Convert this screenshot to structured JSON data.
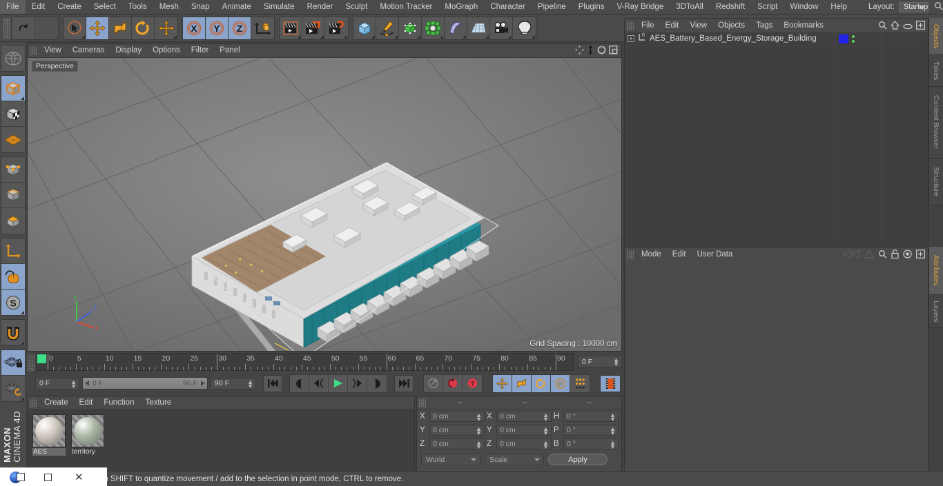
{
  "app": {
    "title": "CINEMA 4D",
    "brand_top": "MAXON",
    "brand_bottom": "CINEMA 4D"
  },
  "menubar": {
    "items": [
      "File",
      "Edit",
      "Create",
      "Select",
      "Tools",
      "Mesh",
      "Snap",
      "Animate",
      "Simulate",
      "Render",
      "Sculpt",
      "Motion Tracker",
      "MoGraph",
      "Character",
      "Pipeline",
      "Plugins",
      "V-Ray Bridge",
      "3DToAll",
      "Redshift",
      "Script",
      "Window",
      "Help"
    ],
    "layout_label": "Layout:",
    "layout_value": "Startup",
    "search_icon": "search-icon"
  },
  "toolbar": {
    "groups": [
      {
        "name": "undo-redo",
        "buttons": [
          {
            "name": "undo-button",
            "icon": "undo-arrow-icon",
            "selected": false,
            "dim": false
          },
          {
            "name": "redo-button",
            "icon": "redo-arrow-icon",
            "selected": false,
            "dim": true
          }
        ]
      },
      {
        "name": "transform-tools",
        "buttons": [
          {
            "name": "live-selection-tool",
            "icon": "cursor-circle-icon",
            "selected": false,
            "dim": false
          },
          {
            "name": "move-tool",
            "icon": "move-arrows-icon",
            "selected": true,
            "dim": false
          },
          {
            "name": "scale-tool",
            "icon": "scale-box-icon",
            "selected": false,
            "dim": false
          },
          {
            "name": "rotate-tool",
            "icon": "rotate-arc-icon",
            "selected": false,
            "dim": false
          },
          {
            "name": "dynamic-place-tool",
            "icon": "move-arrows-icon",
            "selected": false,
            "dim": false
          }
        ]
      },
      {
        "name": "axis-locks",
        "buttons": [
          {
            "name": "lock-x-axis-button",
            "icon": "x-axis-icon",
            "selected": true,
            "dim": false
          },
          {
            "name": "lock-y-axis-button",
            "icon": "y-axis-icon",
            "selected": true,
            "dim": false
          },
          {
            "name": "lock-z-axis-button",
            "icon": "z-axis-icon",
            "selected": true,
            "dim": false
          },
          {
            "name": "world-object-axis-button",
            "icon": "world-axis-cube-icon",
            "selected": false,
            "dim": false
          }
        ]
      },
      {
        "name": "render-tools",
        "buttons": [
          {
            "name": "render-view-button",
            "icon": "clapper-view-icon",
            "selected": false,
            "dim": false
          },
          {
            "name": "render-to-picture-viewer-button",
            "icon": "clapper-picture-icon",
            "selected": false,
            "dim": false
          },
          {
            "name": "render-settings-button",
            "icon": "clapper-gear-icon",
            "selected": false,
            "dim": false
          }
        ]
      },
      {
        "name": "object-creation",
        "buttons": [
          {
            "name": "add-cube-button",
            "icon": "cube-blue-icon",
            "selected": false,
            "dim": false
          },
          {
            "name": "add-spline-button",
            "icon": "pen-spline-icon",
            "selected": false,
            "dim": false
          },
          {
            "name": "nurbs-button",
            "icon": "green-cube-points-icon",
            "selected": false,
            "dim": false
          },
          {
            "name": "array-button",
            "icon": "green-cluster-icon",
            "selected": false,
            "dim": false
          },
          {
            "name": "deformer-button",
            "icon": "bend-deformer-icon",
            "selected": false,
            "dim": false
          },
          {
            "name": "scene-object-button",
            "icon": "floor-grid-icon",
            "selected": false,
            "dim": false
          },
          {
            "name": "camera-button",
            "icon": "camera-icon",
            "selected": false,
            "dim": false
          },
          {
            "name": "light-button",
            "icon": "light-bulb-icon",
            "selected": false,
            "dim": false
          }
        ]
      }
    ]
  },
  "left_toolbar": {
    "groups": [
      {
        "name": "world-axis",
        "buttons": [
          {
            "name": "make-editable-globe-button",
            "icon": "globe-wire-icon",
            "selected": false
          }
        ]
      },
      {
        "name": "mode-selection",
        "buttons": [
          {
            "name": "model-mode-button",
            "icon": "model-cube-icon",
            "selected": true
          },
          {
            "name": "texture-mode-button",
            "icon": "texture-checker-cube-icon",
            "selected": false
          },
          {
            "name": "polygon-grid-button",
            "icon": "orange-grid-icon",
            "selected": false
          }
        ]
      },
      {
        "name": "component-modes",
        "buttons": [
          {
            "name": "point-mode-button",
            "icon": "point-cube-icon",
            "selected": false
          },
          {
            "name": "edge-mode-button",
            "icon": "edge-cube-icon",
            "selected": false
          },
          {
            "name": "polygon-mode-button",
            "icon": "polygon-cube-icon",
            "selected": false
          }
        ]
      },
      {
        "name": "axis-modes",
        "buttons": [
          {
            "name": "enable-axis-button",
            "icon": "axis-arrow-icon",
            "selected": false
          },
          {
            "name": "viewport-solo-button",
            "icon": "mouse-curve-icon",
            "selected": true
          },
          {
            "name": "soft-selection-button",
            "icon": "s-circle-icon",
            "selected": true
          }
        ]
      },
      {
        "name": "snapping",
        "buttons": [
          {
            "name": "snap-magnet-button",
            "icon": "magnet-icon",
            "selected": false
          }
        ]
      },
      {
        "name": "workplane",
        "buttons": [
          {
            "name": "lock-workplane-button",
            "icon": "grid-lock-icon",
            "selected": true
          },
          {
            "name": "planar-workplane-button",
            "icon": "grid-rotate-icon",
            "selected": false
          }
        ]
      }
    ]
  },
  "viewport": {
    "menu": [
      "View",
      "Cameras",
      "Display",
      "Options",
      "Filter",
      "Panel"
    ],
    "corner_icons": [
      "pan-icon",
      "dolly-icon",
      "rotate-icon",
      "maximize-icon"
    ],
    "label": "Perspective",
    "grid_spacing": "Grid Spacing : 10000 cm",
    "axis_gizmo": {
      "x": "X",
      "y": "Y",
      "z": "Z",
      "x_color": "#e04a3c",
      "y_color": "#46c246",
      "z_color": "#4060e0"
    },
    "model_title": "AES Battery Based Energy Storage Building"
  },
  "timeline": {
    "ruler": {
      "labels": [
        "0",
        "5",
        "10",
        "15",
        "20",
        "25",
        "30",
        "35",
        "40",
        "45",
        "50",
        "55",
        "60",
        "65",
        "70",
        "75",
        "80",
        "85",
        "90"
      ],
      "min_frame": 0,
      "max_frame": 90,
      "playhead_frames": [
        0,
        30,
        60,
        90
      ]
    },
    "current_frame_top": "0 F",
    "current_frame": "0 F",
    "range_start": "0 F",
    "range_end": "90 F",
    "end_frame": "90 F",
    "transport": [
      {
        "name": "go-to-start-button",
        "icon": "skip-start-icon"
      },
      {
        "name": "step-back-keyframe-button",
        "icon": "prev-key-icon"
      },
      {
        "name": "step-back-frame-button",
        "icon": "step-back-icon"
      },
      {
        "name": "play-button",
        "icon": "play-icon"
      },
      {
        "name": "step-forward-frame-button",
        "icon": "step-forward-icon"
      },
      {
        "name": "next-keyframe-button",
        "icon": "next-key-icon"
      },
      {
        "name": "go-to-end-button",
        "icon": "skip-end-icon"
      }
    ],
    "record_group": [
      {
        "name": "autokey-button",
        "icon": "key-icon",
        "selected": false
      },
      {
        "name": "record-active-objects-button",
        "icon": "record-circle-icon",
        "selected": false
      },
      {
        "name": "keyframe-selection-button",
        "icon": "question-circle-icon",
        "selected": false
      }
    ],
    "key_toggles": [
      {
        "name": "position-key-button",
        "icon": "move-arrows-icon",
        "selected": true
      },
      {
        "name": "scale-key-button",
        "icon": "scale-box-icon",
        "selected": true
      },
      {
        "name": "rotation-key-button",
        "icon": "rotate-arc-icon",
        "selected": true
      },
      {
        "name": "parameter-key-button",
        "icon": "p-circle-icon",
        "selected": true
      },
      {
        "name": "point-level-animation-button",
        "icon": "dots-grid-icon",
        "selected": false
      }
    ],
    "timeline_button": {
      "name": "open-timeline-button",
      "icon": "film-strip-icon",
      "selected": true
    }
  },
  "materials": {
    "menu": [
      "Create",
      "Edit",
      "Function",
      "Texture"
    ],
    "items": [
      {
        "name": "AES",
        "selected": true,
        "color": "#cfc7bd"
      },
      {
        "name": "territory",
        "selected": false,
        "color": "#a9b7a2"
      }
    ]
  },
  "coordinates": {
    "header_dashes": [
      "--",
      "--",
      "--"
    ],
    "rows": [
      {
        "pos_label": "X",
        "pos_value": "0 cm",
        "size_label": "X",
        "size_value": "0 cm",
        "rot_label": "H",
        "rot_value": "0 °"
      },
      {
        "pos_label": "Y",
        "pos_value": "0 cm",
        "size_label": "Y",
        "size_value": "0 cm",
        "rot_label": "P",
        "rot_value": "0 °"
      },
      {
        "pos_label": "Z",
        "pos_value": "0 cm",
        "size_label": "Z",
        "size_value": "0 cm",
        "rot_label": "B",
        "rot_value": "0 °"
      }
    ],
    "coord_system": "World",
    "size_mode": "Scale",
    "apply_label": "Apply"
  },
  "objects_panel": {
    "menu": [
      "File",
      "Edit",
      "View",
      "Objects",
      "Tags",
      "Bookmarks"
    ],
    "icons": [
      "search-icon",
      "home-icon",
      "eye-icon",
      "plus-box-icon"
    ],
    "rows": [
      {
        "name": "AES_Battery_Based_Energy_Storage_Building",
        "expand": "+",
        "layer_color": "#2323e8",
        "dots": 2
      }
    ]
  },
  "attributes_panel": {
    "menu": [
      "Mode",
      "Edit",
      "User Data"
    ],
    "icons": [
      "back-nav-icon",
      "forward-nav-icon",
      "search-icon",
      "lock-icon",
      "target-icon",
      "plus-box-icon"
    ]
  },
  "right_tabs": {
    "top": [
      {
        "label": "Objects",
        "active": true
      },
      {
        "label": "Takes",
        "active": false
      },
      {
        "label": "Content Browser",
        "active": false
      },
      {
        "label": "Structure",
        "active": false
      }
    ],
    "bottom": [
      {
        "label": "Attributes",
        "active": true
      },
      {
        "label": "Layers",
        "active": false
      }
    ]
  },
  "statusbar": {
    "text": "Move elements. Hold down SHIFT to quantize movement / add to the selection in point mode, CTRL to remove."
  },
  "os_overlay": {
    "icons": [
      "c4d-app-icon",
      "restore-window-icon",
      "close-window-icon"
    ]
  }
}
